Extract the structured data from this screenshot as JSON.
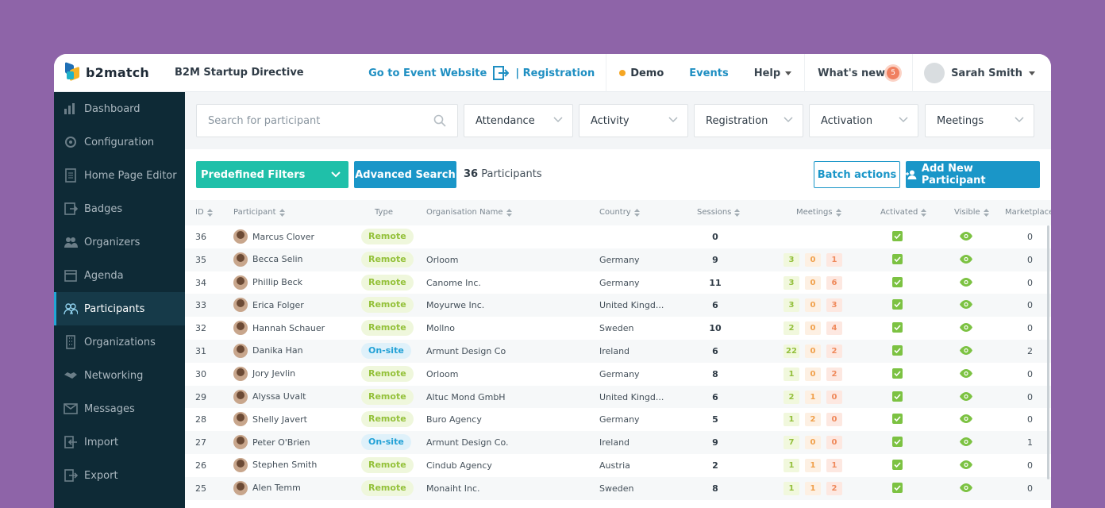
{
  "app": {
    "brand": "b2match",
    "event_name": "B2M Startup Directive"
  },
  "topnav": {
    "go_to_event": "Go to Event Website",
    "registration": "| Registration",
    "demo": "Demo",
    "events": "Events",
    "help": "Help",
    "whats_new": "What's new",
    "whats_new_count": "5",
    "user": "Sarah Smith"
  },
  "sidebar": {
    "items": [
      {
        "label": "Dashboard",
        "icon": "chart-icon"
      },
      {
        "label": "Configuration",
        "icon": "gear-icon"
      },
      {
        "label": "Home Page Editor",
        "icon": "page-icon"
      },
      {
        "label": "Badges",
        "icon": "badge-icon"
      },
      {
        "label": "Organizers",
        "icon": "organizers-icon"
      },
      {
        "label": "Agenda",
        "icon": "calendar-icon"
      },
      {
        "label": "Participants",
        "icon": "participants-icon",
        "active": true
      },
      {
        "label": "Organizations",
        "icon": "building-icon"
      },
      {
        "label": "Networking",
        "icon": "handshake-icon"
      },
      {
        "label": "Messages",
        "icon": "envelope-icon"
      },
      {
        "label": "Import",
        "icon": "import-icon"
      },
      {
        "label": "Export",
        "icon": "export-icon"
      }
    ]
  },
  "filters": {
    "search_placeholder": "Search for participant",
    "selects": [
      "Attendance",
      "Activity",
      "Registration",
      "Activation",
      "Meetings"
    ]
  },
  "actions": {
    "predefined": "Predefined Filters",
    "advanced": "Advanced Search",
    "count": "36",
    "count_label": "Participants",
    "batch": "Batch actions",
    "add": "Add New Participant"
  },
  "table": {
    "headers": [
      "ID",
      "Participant",
      "Type",
      "Organisation Name",
      "Country",
      "Sessions",
      "Meetings",
      "Activated",
      "Visible",
      "Marketplace"
    ],
    "rows": [
      {
        "id": "36",
        "name": "Marcus Clover",
        "type": "Remote",
        "org": "",
        "country": "",
        "sessions": "0",
        "meetings": [],
        "market": "0"
      },
      {
        "id": "35",
        "name": "Becca Selin",
        "type": "Remote",
        "org": "Orloom",
        "country": "Germany",
        "sessions": "9",
        "meetings": [
          "3",
          "0",
          "1"
        ],
        "market": "0"
      },
      {
        "id": "34",
        "name": "Phillip Beck",
        "type": "Remote",
        "org": "Canome Inc.",
        "country": "Germany",
        "sessions": "11",
        "meetings": [
          "3",
          "0",
          "6"
        ],
        "market": "0"
      },
      {
        "id": "33",
        "name": "Erica Folger",
        "type": "Remote",
        "org": "Moyurwe Inc.",
        "country": "United Kingd...",
        "sessions": "6",
        "meetings": [
          "3",
          "0",
          "3"
        ],
        "market": "0"
      },
      {
        "id": "32",
        "name": "Hannah Schauer",
        "type": "Remote",
        "org": "Mollno",
        "country": "Sweden",
        "sessions": "10",
        "meetings": [
          "2",
          "0",
          "4"
        ],
        "market": "0"
      },
      {
        "id": "31",
        "name": "Danika Han",
        "type": "On-site",
        "org": "Armunt Design Co",
        "country": "Ireland",
        "sessions": "6",
        "meetings": [
          "22",
          "0",
          "2"
        ],
        "market": "2"
      },
      {
        "id": "30",
        "name": "Jory Jevlin",
        "type": "Remote",
        "org": "Orloom",
        "country": "Germany",
        "sessions": "8",
        "meetings": [
          "1",
          "0",
          "2"
        ],
        "market": "0"
      },
      {
        "id": "29",
        "name": "Alyssa Uvalt",
        "type": "Remote",
        "org": "Altuc Mond GmbH",
        "country": "United Kingd...",
        "sessions": "6",
        "meetings": [
          "2",
          "1",
          "0"
        ],
        "market": "0"
      },
      {
        "id": "28",
        "name": "Shelly Javert",
        "type": "Remote",
        "org": "Buro Agency",
        "country": "Germany",
        "sessions": "5",
        "meetings": [
          "1",
          "2",
          "0"
        ],
        "market": "0"
      },
      {
        "id": "27",
        "name": "Peter O'Brien",
        "type": "On-site",
        "org": "Armunt Design Co.",
        "country": "Ireland",
        "sessions": "9",
        "meetings": [
          "7",
          "0",
          "0"
        ],
        "market": "1"
      },
      {
        "id": "26",
        "name": "Stephen Smith",
        "type": "Remote",
        "org": "Cindub Agency",
        "country": "Austria",
        "sessions": "2",
        "meetings": [
          "1",
          "1",
          "1"
        ],
        "market": "0"
      },
      {
        "id": "25",
        "name": "Alen Temm",
        "type": "Remote",
        "org": "Monaiht Inc.",
        "country": "Sweden",
        "sessions": "8",
        "meetings": [
          "1",
          "1",
          "2"
        ],
        "market": "0"
      }
    ]
  }
}
